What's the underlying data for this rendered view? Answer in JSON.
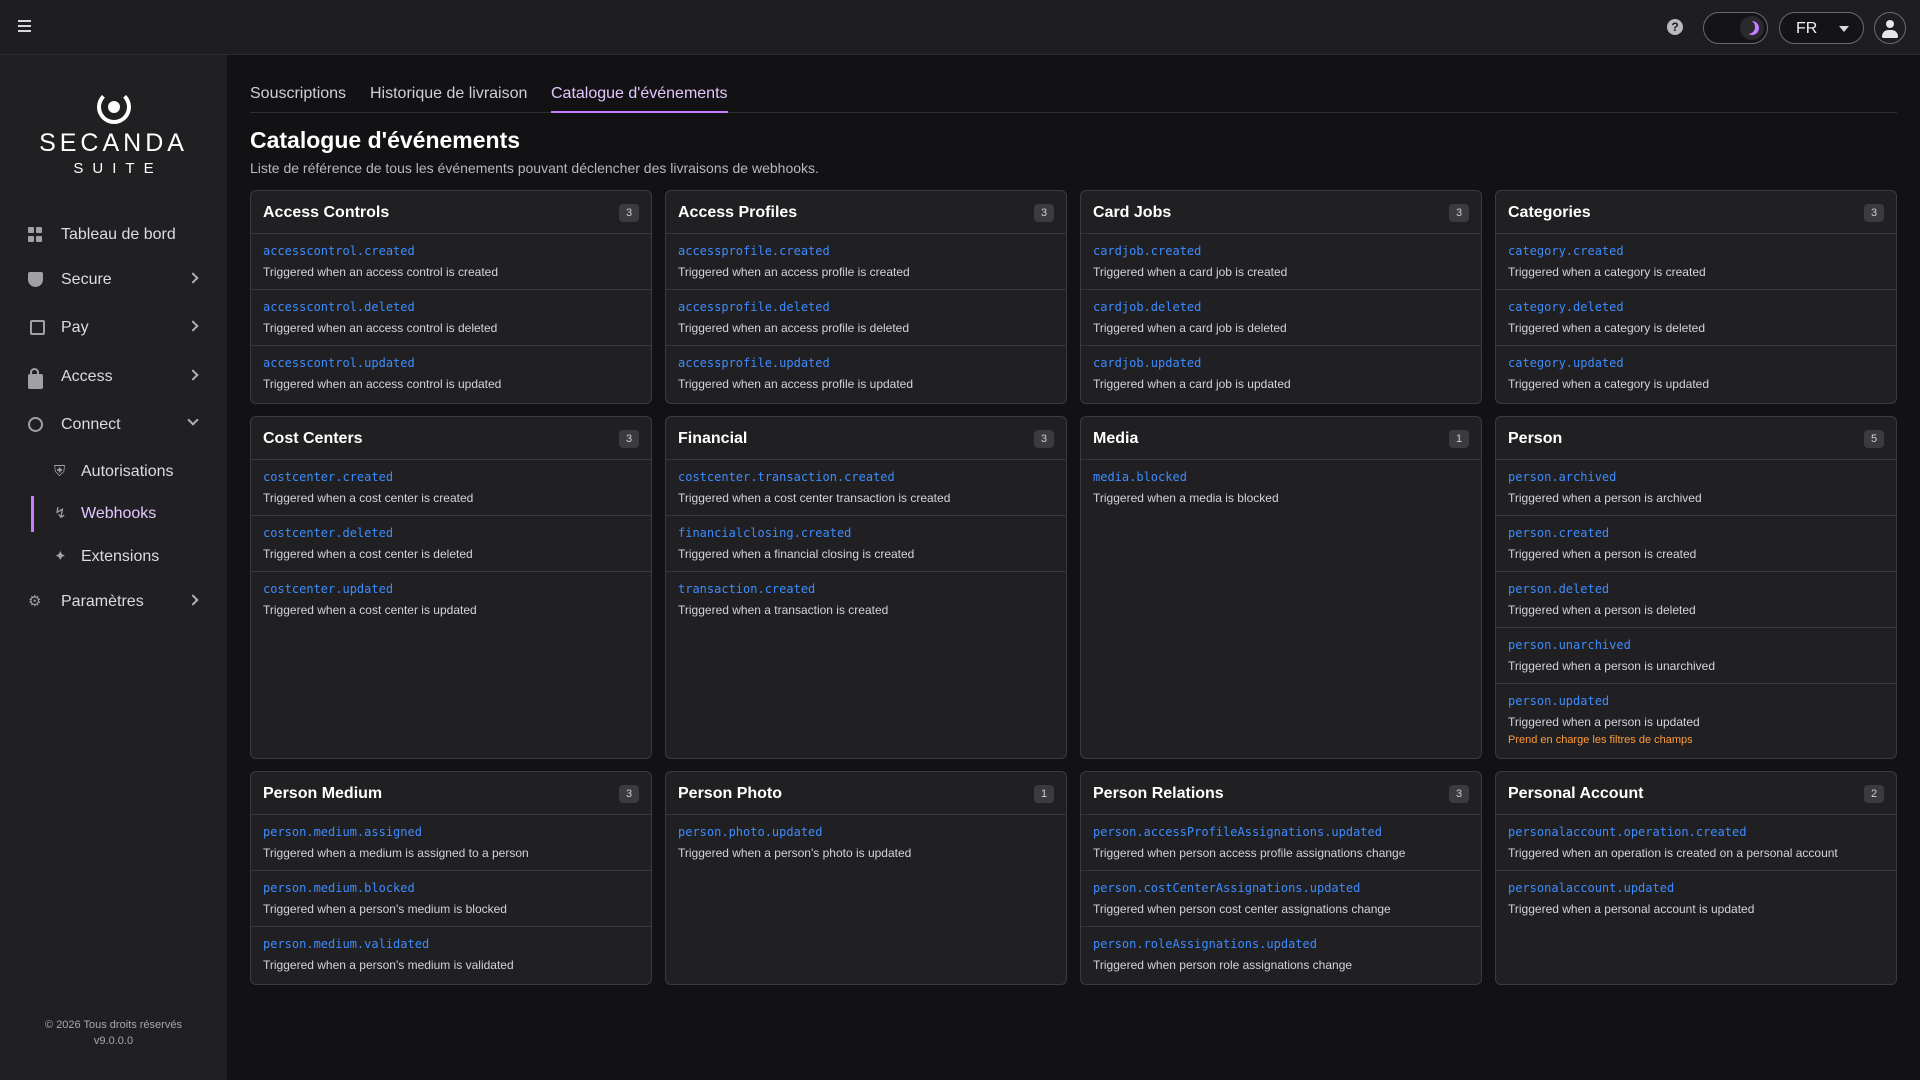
{
  "header": {
    "lang": "FR",
    "icons": [
      "menu-icon",
      "help-icon",
      "moon-icon",
      "chevron-down-icon",
      "user-icon"
    ]
  },
  "sidebar": {
    "logo_name": "SECANDA",
    "logo_sub": "SUITE",
    "items": [
      {
        "label": "Tableau de bord",
        "icon": "dashboard-icon"
      },
      {
        "label": "Secure",
        "icon": "shield-icon"
      },
      {
        "label": "Pay",
        "icon": "phone-icon"
      },
      {
        "label": "Access",
        "icon": "lock-icon"
      },
      {
        "label": "Connect",
        "icon": "globe-icon"
      },
      {
        "label": "Autorisations",
        "icon": "shield-small-icon"
      },
      {
        "label": "Webhooks",
        "icon": "webhook-icon"
      },
      {
        "label": "Extensions",
        "icon": "puzzle-icon"
      },
      {
        "label": "Paramètres",
        "icon": "gear-icon"
      }
    ],
    "footer_copyright": "© 2026 Tous droits réservés",
    "footer_version": "v9.0.0.0"
  },
  "tabs": [
    {
      "label": "Souscriptions"
    },
    {
      "label": "Historique de livraison"
    },
    {
      "label": "Catalogue d'événements"
    }
  ],
  "page": {
    "title": "Catalogue d'événements",
    "subtitle": "Liste de référence de tous les événements pouvant déclencher des livraisons de webhooks."
  },
  "cards": [
    {
      "title": "Access Controls",
      "count": "3",
      "events": [
        {
          "name": "accesscontrol.created",
          "desc": "Triggered when an access control is created"
        },
        {
          "name": "accesscontrol.deleted",
          "desc": "Triggered when an access control is deleted"
        },
        {
          "name": "accesscontrol.updated",
          "desc": "Triggered when an access control is updated"
        }
      ]
    },
    {
      "title": "Access Profiles",
      "count": "3",
      "events": [
        {
          "name": "accessprofile.created",
          "desc": "Triggered when an access profile is created"
        },
        {
          "name": "accessprofile.deleted",
          "desc": "Triggered when an access profile is deleted"
        },
        {
          "name": "accessprofile.updated",
          "desc": "Triggered when an access profile is updated"
        }
      ]
    },
    {
      "title": "Card Jobs",
      "count": "3",
      "events": [
        {
          "name": "cardjob.created",
          "desc": "Triggered when a card job is created"
        },
        {
          "name": "cardjob.deleted",
          "desc": "Triggered when a card job is deleted"
        },
        {
          "name": "cardjob.updated",
          "desc": "Triggered when a card job is updated"
        }
      ]
    },
    {
      "title": "Categories",
      "count": "3",
      "events": [
        {
          "name": "category.created",
          "desc": "Triggered when a category is created"
        },
        {
          "name": "category.deleted",
          "desc": "Triggered when a category is deleted"
        },
        {
          "name": "category.updated",
          "desc": "Triggered when a category is updated"
        }
      ]
    },
    {
      "title": "Cost Centers",
      "count": "3",
      "events": [
        {
          "name": "costcenter.created",
          "desc": "Triggered when a cost center is created"
        },
        {
          "name": "costcenter.deleted",
          "desc": "Triggered when a cost center is deleted"
        },
        {
          "name": "costcenter.updated",
          "desc": "Triggered when a cost center is updated"
        }
      ]
    },
    {
      "title": "Financial",
      "count": "3",
      "events": [
        {
          "name": "costcenter.transaction.created",
          "desc": "Triggered when a cost center transaction is created"
        },
        {
          "name": "financialclosing.created",
          "desc": "Triggered when a financial closing is created"
        },
        {
          "name": "transaction.created",
          "desc": "Triggered when a transaction is created"
        }
      ]
    },
    {
      "title": "Media",
      "count": "1",
      "events": [
        {
          "name": "media.blocked",
          "desc": "Triggered when a media is blocked"
        }
      ]
    },
    {
      "title": "Person",
      "count": "5",
      "events": [
        {
          "name": "person.archived",
          "desc": "Triggered when a person is archived"
        },
        {
          "name": "person.created",
          "desc": "Triggered when a person is created"
        },
        {
          "name": "person.deleted",
          "desc": "Triggered when a person is deleted"
        },
        {
          "name": "person.unarchived",
          "desc": "Triggered when a person is unarchived"
        },
        {
          "name": "person.updated",
          "desc": "Triggered when a person is updated",
          "note": "Prend en charge les filtres de champs"
        }
      ]
    },
    {
      "title": "Person Medium",
      "count": "3",
      "events": [
        {
          "name": "person.medium.assigned",
          "desc": "Triggered when a medium is assigned to a person"
        },
        {
          "name": "person.medium.blocked",
          "desc": "Triggered when a person's medium is blocked"
        },
        {
          "name": "person.medium.validated",
          "desc": "Triggered when a person's medium is validated"
        }
      ]
    },
    {
      "title": "Person Photo",
      "count": "1",
      "events": [
        {
          "name": "person.photo.updated",
          "desc": "Triggered when a person's photo is updated"
        }
      ]
    },
    {
      "title": "Person Relations",
      "count": "3",
      "events": [
        {
          "name": "person.accessProfileAssignations.updated",
          "desc": "Triggered when person access profile assignations change"
        },
        {
          "name": "person.costCenterAssignations.updated",
          "desc": "Triggered when person cost center assignations change"
        },
        {
          "name": "person.roleAssignations.updated",
          "desc": "Triggered when person role assignations change"
        }
      ]
    },
    {
      "title": "Personal Account",
      "count": "2",
      "events": [
        {
          "name": "personalaccount.operation.created",
          "desc": "Triggered when an operation is created on a personal account"
        },
        {
          "name": "personalaccount.updated",
          "desc": "Triggered when a personal account is updated"
        }
      ]
    }
  ]
}
